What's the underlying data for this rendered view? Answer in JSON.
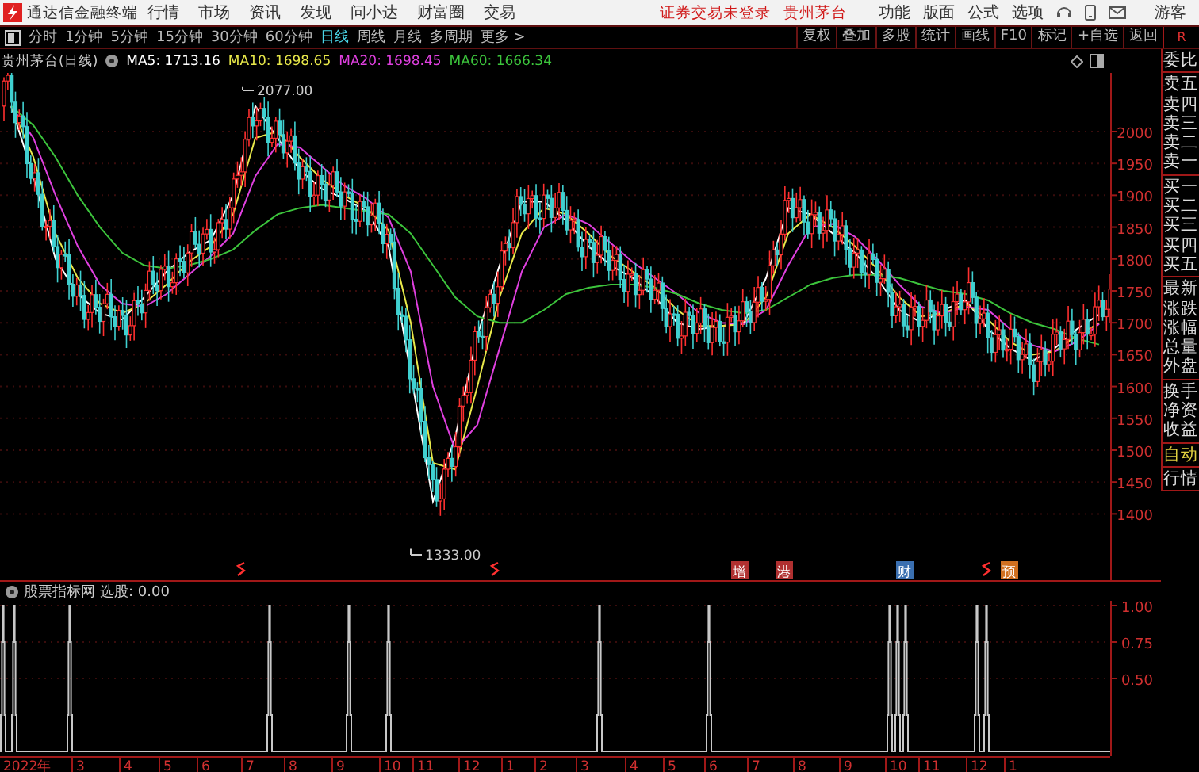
{
  "title_bar": {
    "app_name": "通达信金融终端",
    "menus": [
      "行情",
      "市场",
      "资讯",
      "发现",
      "问小达",
      "财富圈",
      "交易"
    ],
    "login_status": "证券交易未登录",
    "stock_name": "贵州茅台",
    "tools": [
      "功能",
      "版面",
      "公式",
      "选项"
    ],
    "user": "游客"
  },
  "period_tabs": [
    {
      "label": "分时",
      "selected": false
    },
    {
      "label": "1分钟",
      "selected": false
    },
    {
      "label": "5分钟",
      "selected": false
    },
    {
      "label": "15分钟",
      "selected": false
    },
    {
      "label": "30分钟",
      "selected": false
    },
    {
      "label": "60分钟",
      "selected": false
    },
    {
      "label": "日线",
      "selected": true
    },
    {
      "label": "周线",
      "selected": false
    },
    {
      "label": "月线",
      "selected": false
    },
    {
      "label": "多周期",
      "selected": false
    },
    {
      "label": "更多 >",
      "selected": false
    }
  ],
  "chart_tools": [
    "复权",
    "叠加",
    "多股",
    "统计",
    "画线",
    "F10",
    "标记",
    "+自选",
    "返回"
  ],
  "side_tab": "R",
  "main_chart": {
    "title": "贵州茅台(日线)",
    "high_label": "2077.00",
    "low_label": "1333.00",
    "events": [
      {
        "kind": "icon"
      },
      {
        "kind": "icon"
      },
      {
        "kind": "text",
        "label": "增",
        "color": "#b03030"
      },
      {
        "kind": "text",
        "label": "港",
        "color": "#b03030"
      },
      {
        "kind": "text",
        "label": "财",
        "color": "#3a6fb0"
      },
      {
        "kind": "icon"
      },
      {
        "kind": "text",
        "label": "预",
        "color": "#d07020"
      }
    ],
    "chart_data": {
      "type": "line",
      "ylim": [
        1296,
        2092
      ],
      "grid": true,
      "yticks": [
        2000,
        1950,
        1900,
        1850,
        1800,
        1750,
        1700,
        1650,
        1600,
        1550,
        1500,
        1450,
        1400
      ],
      "series": [
        {
          "name": "MA5: 1713.16",
          "color": "#ffffff",
          "values": [
            2040,
            1930,
            1800,
            1745,
            1715,
            1705,
            1740,
            1780,
            1810,
            1830,
            1900,
            2040,
            1990,
            1940,
            1910,
            1895,
            1875,
            1820,
            1620,
            1420,
            1520,
            1680,
            1790,
            1890,
            1890,
            1860,
            1820,
            1790,
            1770,
            1740,
            1700,
            1690,
            1695,
            1700,
            1770,
            1880,
            1870,
            1840,
            1810,
            1770,
            1720,
            1700,
            1720,
            1735,
            1690,
            1660,
            1640,
            1660,
            1690,
            1713
          ]
        },
        {
          "name": "MA10: 1698.65",
          "color": "#e8e84a",
          "values": [
            2040,
            1960,
            1840,
            1770,
            1730,
            1715,
            1730,
            1760,
            1795,
            1820,
            1870,
            1990,
            2000,
            1960,
            1925,
            1900,
            1880,
            1845,
            1700,
            1480,
            1470,
            1600,
            1740,
            1840,
            1880,
            1870,
            1840,
            1805,
            1780,
            1755,
            1720,
            1695,
            1695,
            1698,
            1740,
            1840,
            1870,
            1850,
            1820,
            1785,
            1740,
            1710,
            1715,
            1730,
            1705,
            1670,
            1650,
            1655,
            1680,
            1699
          ]
        },
        {
          "name": "MA20: 1698.45",
          "color": "#e040e0",
          "values": [
            2040,
            1990,
            1900,
            1820,
            1760,
            1730,
            1725,
            1745,
            1775,
            1805,
            1840,
            1930,
            1980,
            1975,
            1945,
            1915,
            1895,
            1865,
            1780,
            1600,
            1500,
            1540,
            1660,
            1780,
            1850,
            1870,
            1855,
            1825,
            1795,
            1770,
            1745,
            1715,
            1700,
            1698,
            1720,
            1790,
            1850,
            1855,
            1835,
            1800,
            1760,
            1725,
            1715,
            1725,
            1720,
            1690,
            1665,
            1655,
            1670,
            1698
          ]
        },
        {
          "name": "MA60: 1666.34",
          "color": "#3cc43c",
          "values": [
            2040,
            2010,
            1960,
            1900,
            1850,
            1810,
            1790,
            1785,
            1790,
            1800,
            1815,
            1845,
            1870,
            1880,
            1885,
            1880,
            1875,
            1870,
            1840,
            1790,
            1740,
            1710,
            1700,
            1700,
            1720,
            1745,
            1755,
            1760,
            1760,
            1755,
            1745,
            1730,
            1720,
            1715,
            1720,
            1740,
            1760,
            1770,
            1775,
            1775,
            1770,
            1760,
            1750,
            1745,
            1735,
            1715,
            1700,
            1690,
            1675,
            1666
          ]
        }
      ]
    }
  },
  "indicator": {
    "name": "股票指标网",
    "reading": "选股: 0.00",
    "y_ticks": [
      "1.00",
      "0.75",
      "0.50"
    ]
  },
  "date_axis": [
    "2022年",
    "3",
    "4",
    "5",
    "6",
    "7",
    "8",
    "9",
    "10",
    "11",
    "12",
    "1",
    "2",
    "3",
    "4",
    "5",
    "6",
    "7",
    "8",
    "9",
    "10",
    "11",
    "12",
    "1"
  ],
  "quote_groups": [
    [
      "委比"
    ],
    [
      "卖五",
      "卖四",
      "卖三",
      "卖二",
      "卖一"
    ],
    [
      "买一",
      "买二",
      "买三",
      "买四",
      "买五"
    ],
    [
      "最新",
      "涨跌",
      "涨幅",
      "总量",
      "外盘"
    ],
    [
      "换手",
      "净资",
      "收益"
    ]
  ],
  "auto_label": "自动",
  "market_label": "行情"
}
